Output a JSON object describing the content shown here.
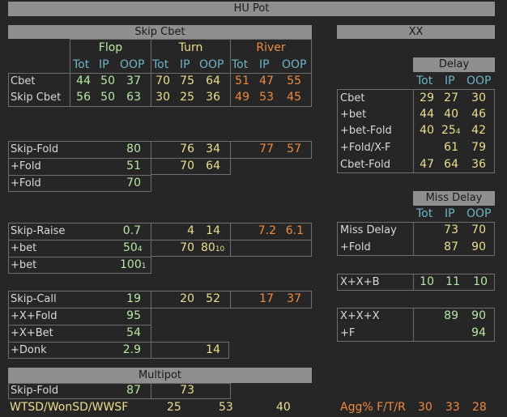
{
  "title": "HU Pot",
  "colors": {
    "flop": "#b4e9a4",
    "turn": "#ecdf8e",
    "river": "#f08a40",
    "header": "#6fb3c8",
    "label": "#d8d8d8",
    "bar": "#8f8f8f"
  },
  "skip_cbet": {
    "title": "Skip Cbet",
    "streets": [
      "Flop",
      "Turn",
      "River"
    ],
    "cols": [
      "Tot",
      "IP",
      "OOP"
    ],
    "rows": [
      {
        "label": "Cbet",
        "flop": [
          "44",
          "50",
          "37"
        ],
        "turn": [
          "70",
          "75",
          "64"
        ],
        "river": [
          "51",
          "47",
          "55"
        ]
      },
      {
        "label": "Skip Cbet",
        "flop": [
          "56",
          "50",
          "63"
        ],
        "turn": [
          "30",
          "25",
          "36"
        ],
        "river": [
          "49",
          "53",
          "45"
        ]
      }
    ]
  },
  "skip_fold": {
    "rows": [
      {
        "label": "Skip-Fold",
        "flop": "80",
        "turn": [
          "76",
          "34"
        ],
        "river": [
          "77",
          "57"
        ]
      },
      {
        "label": "+Fold",
        "flop": "51",
        "turn": [
          "70",
          "64"
        ]
      },
      {
        "label": "+Fold",
        "flop": "70"
      }
    ]
  },
  "skip_raise": {
    "rows": [
      {
        "label": "Skip-Raise",
        "flop": "0.7",
        "turn": [
          "4",
          "14"
        ],
        "river": [
          "7.2",
          "6.1"
        ]
      },
      {
        "label": "+bet",
        "flop": "50",
        "flop_sub": "4",
        "turn": [
          "70",
          "80"
        ],
        "turn_sub": "10"
      },
      {
        "label": "+bet",
        "flop": "100",
        "flop_sub": "1"
      }
    ]
  },
  "skip_call": {
    "rows": [
      {
        "label": "Skip-Call",
        "flop": "19",
        "turn": [
          "20",
          "52"
        ],
        "river": [
          "17",
          "37"
        ]
      },
      {
        "label": "+X+Fold",
        "flop": "95"
      },
      {
        "label": "+X+Bet",
        "flop": "54"
      },
      {
        "label": "+Donk",
        "flop": "2.9",
        "turn": "14"
      }
    ]
  },
  "multipot": {
    "title": "Multipot",
    "rows": [
      {
        "label": "Skip-Fold",
        "flop": "87",
        "turn": "73"
      }
    ]
  },
  "wtsd": {
    "label": "WTSD/WonSD/WWSF",
    "values": [
      "25",
      "53",
      "40"
    ]
  },
  "xx": {
    "title": "XX",
    "delay": {
      "title": "Delay",
      "cols": [
        "Tot",
        "IP",
        "OOP"
      ],
      "rows": [
        {
          "label": "Cbet",
          "values": [
            "29",
            "27",
            "30"
          ]
        },
        {
          "label": "+bet",
          "values": [
            "44",
            "40",
            "46"
          ]
        },
        {
          "label": "+bet-Fold",
          "values": [
            "40",
            "25",
            "42"
          ],
          "sub": "4"
        },
        {
          "label": "+Fold/X-F",
          "values": [
            "",
            "61",
            "79"
          ]
        },
        {
          "label": "Cbet-Fold",
          "values": [
            "47",
            "64",
            "36"
          ]
        }
      ]
    },
    "miss_delay": {
      "title": "Miss Delay",
      "cols": [
        "Tot",
        "IP",
        "OOP"
      ],
      "rows": [
        {
          "label": "Miss Delay",
          "values": [
            "",
            "73",
            "70"
          ]
        },
        {
          "label": "+Fold",
          "values": [
            "",
            "87",
            "90"
          ]
        }
      ]
    },
    "xxb": {
      "label": "X+X+B",
      "values": [
        "10",
        "11",
        "10"
      ]
    },
    "xxx": {
      "rows": [
        {
          "label": "X+X+X",
          "values": [
            "",
            "89",
            "90"
          ]
        },
        {
          "label": "+F",
          "values": [
            "",
            "",
            "94"
          ]
        }
      ]
    },
    "agg": {
      "label": "Agg% F/T/R",
      "values": [
        "30",
        "33",
        "28"
      ]
    }
  }
}
